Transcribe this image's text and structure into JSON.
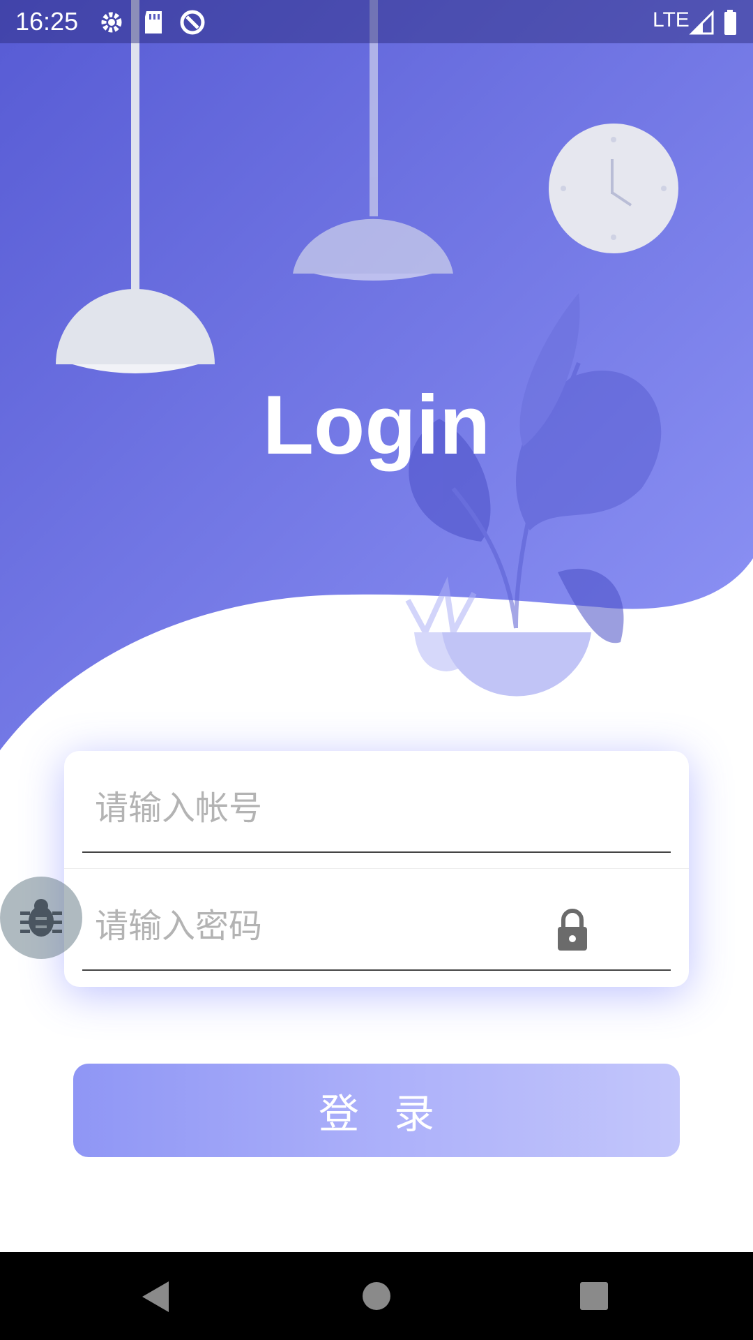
{
  "status_bar": {
    "time": "16:25",
    "network": "LTE",
    "icons": [
      "settings-gear-icon",
      "sd-card-icon",
      "data-saver-icon",
      "signal-icon",
      "battery-icon"
    ]
  },
  "header": {
    "title": "Login"
  },
  "form": {
    "username": {
      "placeholder": "请输入帐号",
      "value": ""
    },
    "password": {
      "placeholder": "请输入密码",
      "value": "",
      "icon": "lock-icon"
    }
  },
  "login_button": {
    "label": "登录"
  },
  "debug_fab": {
    "icon": "bug-icon"
  },
  "nav_bar": {
    "icons": [
      "back-triangle-icon",
      "home-circle-icon",
      "recents-square-icon"
    ]
  },
  "colors": {
    "hero_start": "#5a5fd6",
    "hero_end": "#8c92f5",
    "button_start": "#8f96f5",
    "button_end": "#c3c6fb",
    "card_shadow": "#6e78ff"
  }
}
